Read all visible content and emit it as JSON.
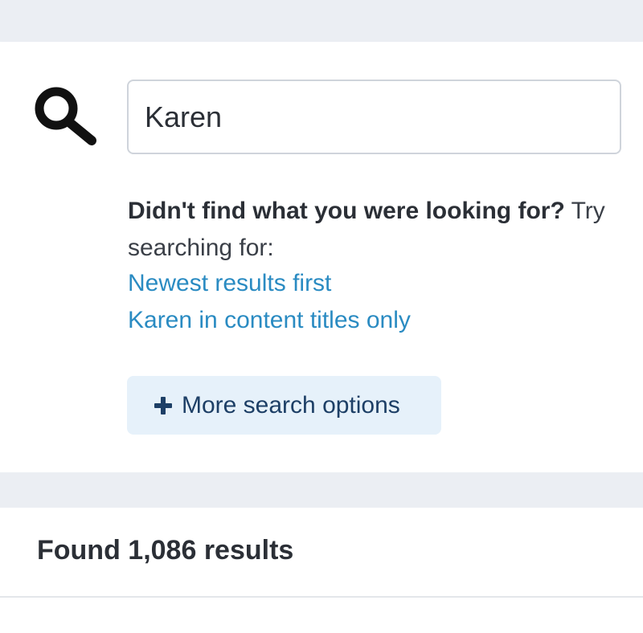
{
  "search": {
    "value": "Karen",
    "icon": "search-icon"
  },
  "suggestions": {
    "prompt_bold": "Didn't find what you were looking for?",
    "prompt_rest": " Try searching for:",
    "links": [
      {
        "label": "Newest results first"
      },
      {
        "label": "Karen in content titles only"
      }
    ]
  },
  "more_options": {
    "icon": "plus-icon",
    "label": "More search options"
  },
  "results": {
    "count_text": "Found 1,086 results"
  },
  "colors": {
    "background": "#ebeef3",
    "link": "#2a8bc2",
    "button_bg": "#e6f1fa",
    "button_text": "#1d3f66"
  }
}
